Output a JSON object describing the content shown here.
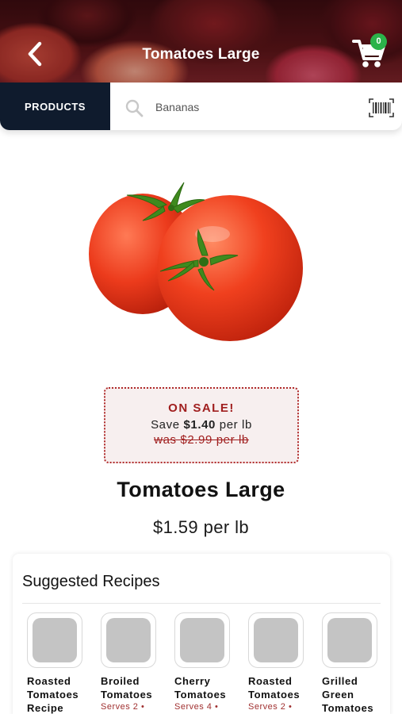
{
  "header": {
    "title": "Tomatoes Large",
    "back_icon": "chevron-left-icon",
    "cart_icon": "shopping-cart-icon",
    "cart_count": "0"
  },
  "search": {
    "category_button": "PRODUCTS",
    "search_icon": "search-icon",
    "query": "Bananas",
    "barcode_icon": "barcode-icon"
  },
  "product": {
    "name": "Tomatoes Large",
    "price": "$1.59 per lb",
    "image": "tomatoes-photo"
  },
  "sale": {
    "title": "ON SALE!",
    "save_prefix": "Save",
    "save_amount": "$1.40",
    "save_suffix": "per lb",
    "was": "was $2.99 per lb"
  },
  "recipes": {
    "title": "Suggested Recipes",
    "items": [
      {
        "name": "Roasted\nTomatoes\nRecipe",
        "serves": ""
      },
      {
        "name": "Broiled\nTomatoes",
        "serves": "Serves 2 •"
      },
      {
        "name": "Cherry\nTomatoes",
        "serves": "Serves 4 •"
      },
      {
        "name": "Roasted\nTomatoes",
        "serves": "Serves 2 •"
      },
      {
        "name": "Grilled\nGreen\nTomatoes",
        "serves": ""
      }
    ]
  },
  "colors": {
    "header_bar": "#0f1b2d",
    "badge": "#2bb34a",
    "sale_red": "#a01e1e"
  }
}
